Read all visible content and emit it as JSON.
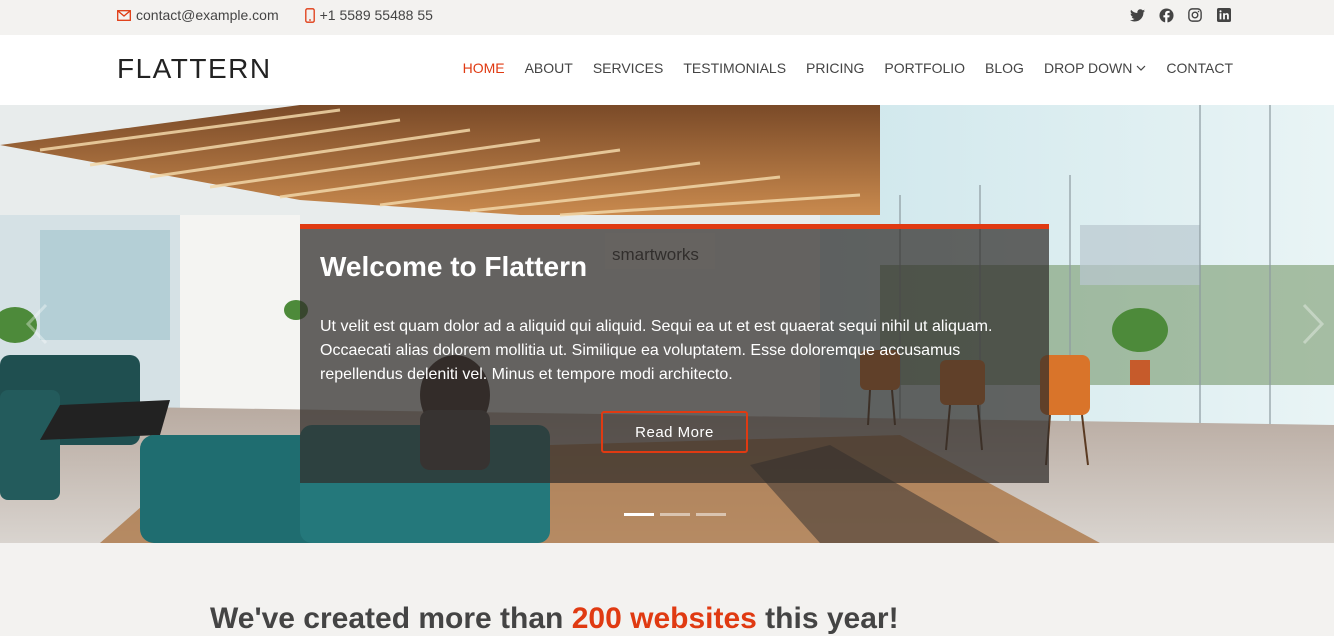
{
  "topbar": {
    "email": "contact@example.com",
    "phone": "+1 5589 55488 55",
    "social": [
      "twitter-icon",
      "facebook-icon",
      "instagram-icon",
      "linkedin-icon"
    ]
  },
  "header": {
    "logo": "FLATTERN",
    "nav": [
      {
        "label": "HOME",
        "active": true
      },
      {
        "label": "ABOUT"
      },
      {
        "label": "SERVICES"
      },
      {
        "label": "TESTIMONIALS"
      },
      {
        "label": "PRICING"
      },
      {
        "label": "PORTFOLIO"
      },
      {
        "label": "BLOG"
      },
      {
        "label": "DROP DOWN",
        "dropdown": true
      },
      {
        "label": "CONTACT"
      }
    ]
  },
  "hero": {
    "title": "Welcome to Flattern",
    "text": "Ut velit est quam dolor ad a aliquid qui aliquid. Sequi ea ut et est quaerat sequi nihil ut aliquam. Occaecati alias dolorem mollitia ut. Similique ea voluptatem. Esse doloremque accusamus repellendus deleniti vel. Minus et tempore modi architecto.",
    "button": "Read More",
    "slides": 3,
    "active_slide": 0,
    "sign_text": "smartworks"
  },
  "section": {
    "title_pre": "We've created more than ",
    "title_highlight": "200 websites",
    "title_post": " this year!"
  },
  "colors": {
    "accent": "#e03a12",
    "topbar_bg": "#f3f2f0"
  }
}
